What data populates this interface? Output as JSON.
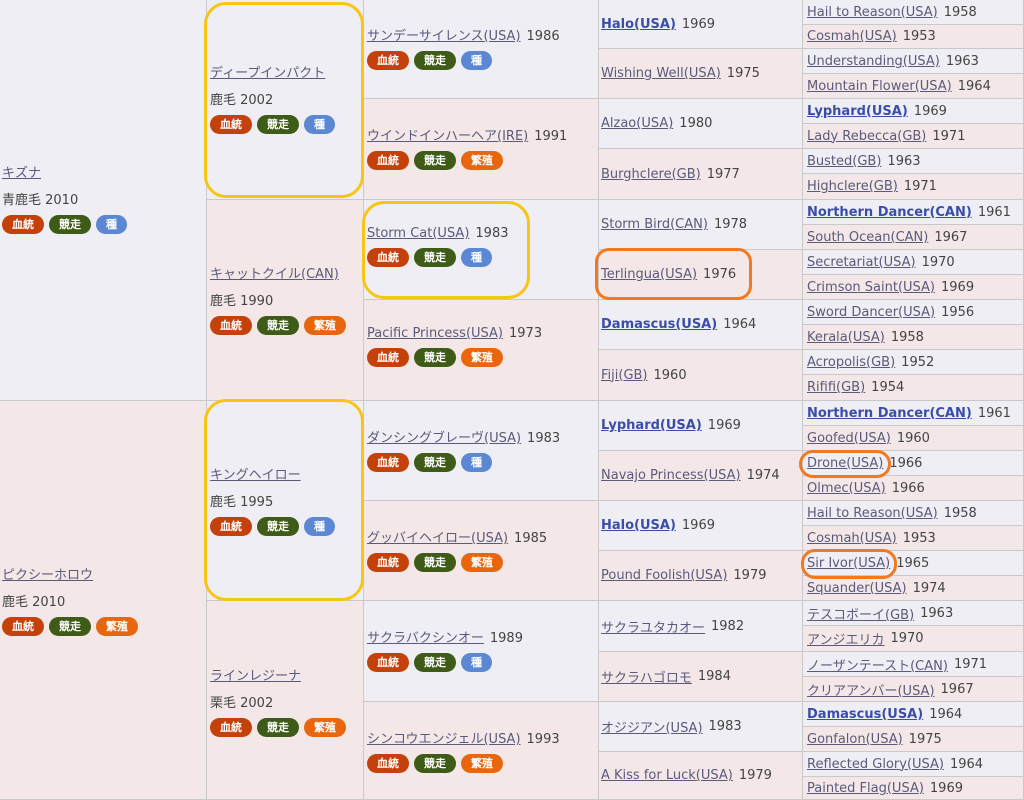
{
  "colors": {
    "bloodline": "#c4410b",
    "racing": "#3e5b17",
    "sire": "#5b87d3",
    "breeding": "#e8660d",
    "highlight_yellow": "#f7c514",
    "highlight_orange": "#f07a22"
  },
  "badge_labels": {
    "bloodline": "血統",
    "racing": "競走",
    "sire": "種",
    "breeding": "繁殖"
  },
  "gen1": [
    {
      "name": "キズナ",
      "info": "青鹿毛 2010",
      "badges": [
        "血統",
        "競走",
        "種"
      ]
    },
    {
      "name": "ピクシーホロウ",
      "info": "鹿毛 2010",
      "badges": [
        "血統",
        "競走",
        "繁殖"
      ]
    }
  ],
  "gen2": [
    {
      "name": "ディープインパクト",
      "info": "鹿毛 2002",
      "badges": [
        "血統",
        "競走",
        "種"
      ]
    },
    {
      "name": "キャットクイル(CAN)",
      "info": "鹿毛 1990",
      "badges": [
        "血統",
        "競走",
        "繁殖"
      ]
    },
    {
      "name": "キングヘイロー",
      "info": "鹿毛 1995",
      "badges": [
        "血統",
        "競走",
        "種"
      ]
    },
    {
      "name": "ラインレジーナ",
      "info": "栗毛 2002",
      "badges": [
        "血統",
        "競走",
        "繁殖"
      ]
    }
  ],
  "gen3": [
    {
      "name": "サンデーサイレンス(USA)",
      "year": "1986",
      "badges": [
        "血統",
        "競走",
        "種"
      ]
    },
    {
      "name": "ウインドインハーヘア(IRE)",
      "year": "1991",
      "badges": [
        "血統",
        "競走",
        "繁殖"
      ]
    },
    {
      "name": "Storm Cat(USA)",
      "year": "1983",
      "badges": [
        "血統",
        "競走",
        "種"
      ]
    },
    {
      "name": "Pacific Princess(USA)",
      "year": "1973",
      "badges": [
        "血統",
        "競走",
        "繁殖"
      ]
    },
    {
      "name": "ダンシングブレーヴ(USA)",
      "year": "1983",
      "badges": [
        "血統",
        "競走",
        "種"
      ]
    },
    {
      "name": "グッバイヘイロー(USA)",
      "year": "1985",
      "badges": [
        "血統",
        "競走",
        "繁殖"
      ]
    },
    {
      "name": "サクラバクシンオー",
      "year": "1989",
      "badges": [
        "血統",
        "競走",
        "種"
      ]
    },
    {
      "name": "シンコウエンジェル(USA)",
      "year": "1993",
      "badges": [
        "血統",
        "競走",
        "繁殖"
      ]
    }
  ],
  "gen4": [
    {
      "name": "Halo(USA)",
      "year": "1969"
    },
    {
      "name": "Wishing Well(USA)",
      "year": "1975"
    },
    {
      "name": "Alzao(USA)",
      "year": "1980"
    },
    {
      "name": "Burghclere(GB)",
      "year": "1977"
    },
    {
      "name": "Storm Bird(CAN)",
      "year": "1978"
    },
    {
      "name": "Terlingua(USA)",
      "year": "1976"
    },
    {
      "name": "Damascus(USA)",
      "year": "1964"
    },
    {
      "name": "Fiji(GB)",
      "year": "1960"
    },
    {
      "name": "Lyphard(USA)",
      "year": "1969"
    },
    {
      "name": "Navajo Princess(USA)",
      "year": "1974"
    },
    {
      "name": "Halo(USA)",
      "year": "1969"
    },
    {
      "name": "Pound Foolish(USA)",
      "year": "1979"
    },
    {
      "name": "サクラユタカオー",
      "year": "1982"
    },
    {
      "name": "サクラハゴロモ",
      "year": "1984"
    },
    {
      "name": "オジジアン(USA)",
      "year": "1983"
    },
    {
      "name": "A Kiss for Luck(USA)",
      "year": "1979"
    }
  ],
  "gen5": [
    {
      "name": "Hail to Reason(USA)",
      "year": "1958"
    },
    {
      "name": "Cosmah(USA)",
      "year": "1953"
    },
    {
      "name": "Understanding(USA)",
      "year": "1963"
    },
    {
      "name": "Mountain Flower(USA)",
      "year": "1964"
    },
    {
      "name": "Lyphard(USA)",
      "year": "1969"
    },
    {
      "name": "Lady Rebecca(GB)",
      "year": "1971"
    },
    {
      "name": "Busted(GB)",
      "year": "1963"
    },
    {
      "name": "Highclere(GB)",
      "year": "1971"
    },
    {
      "name": "Northern Dancer(CAN)",
      "year": "1961"
    },
    {
      "name": "South Ocean(CAN)",
      "year": "1967"
    },
    {
      "name": "Secretariat(USA)",
      "year": "1970"
    },
    {
      "name": "Crimson Saint(USA)",
      "year": "1969"
    },
    {
      "name": "Sword Dancer(USA)",
      "year": "1956"
    },
    {
      "name": "Kerala(USA)",
      "year": "1958"
    },
    {
      "name": "Acropolis(GB)",
      "year": "1952"
    },
    {
      "name": "Rififi(GB)",
      "year": "1954"
    },
    {
      "name": "Northern Dancer(CAN)",
      "year": "1961"
    },
    {
      "name": "Goofed(USA)",
      "year": "1960"
    },
    {
      "name": "Drone(USA)",
      "year": "1966"
    },
    {
      "name": "Olmec(USA)",
      "year": "1966"
    },
    {
      "name": "Hail to Reason(USA)",
      "year": "1958"
    },
    {
      "name": "Cosmah(USA)",
      "year": "1953"
    },
    {
      "name": "Sir Ivor(USA)",
      "year": "1965"
    },
    {
      "name": "Squander(USA)",
      "year": "1974"
    },
    {
      "name": "テスコボーイ(GB)",
      "year": "1963"
    },
    {
      "name": "アンジエリカ",
      "year": "1970"
    },
    {
      "name": "ノーザンテースト(CAN)",
      "year": "1971"
    },
    {
      "name": "クリアアンバー(USA)",
      "year": "1967"
    },
    {
      "name": "Damascus(USA)",
      "year": "1964"
    },
    {
      "name": "Gonfalon(USA)",
      "year": "1975"
    },
    {
      "name": "Reflected Glory(USA)",
      "year": "1964"
    },
    {
      "name": "Painted Flag(USA)",
      "year": "1969"
    }
  ]
}
